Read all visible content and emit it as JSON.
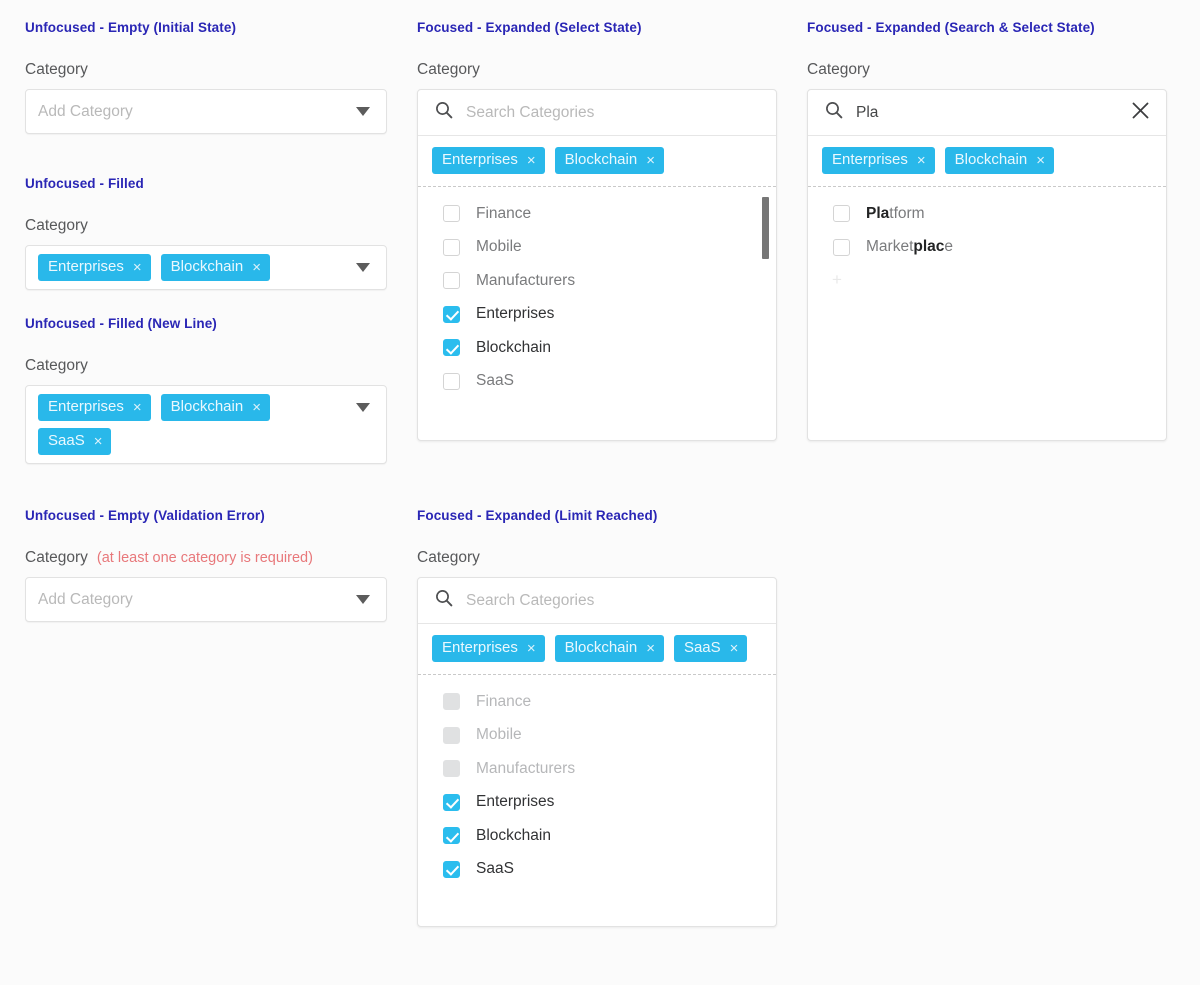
{
  "page": {
    "background": "#fbfbfb",
    "accent_color": "#29b8ea",
    "title_color": "#2a26b5",
    "error_color": "#e8787b"
  },
  "panels": {
    "initial": {
      "state_title": "Unfocused - Empty (Initial State)",
      "field_label": "Category",
      "placeholder": "Add Category"
    },
    "filled": {
      "state_title": "Unfocused - Filled",
      "field_label": "Category",
      "chips": [
        {
          "label": "Enterprises",
          "close": "×"
        },
        {
          "label": "Blockchain",
          "close": "×"
        }
      ]
    },
    "filled_newline": {
      "state_title": "Unfocused - Filled (New Line)",
      "field_label": "Category",
      "chips": [
        {
          "label": "Enterprises",
          "close": "×"
        },
        {
          "label": "Blockchain",
          "close": "×"
        },
        {
          "label": "SaaS",
          "close": "×"
        }
      ]
    },
    "validation_error": {
      "state_title": "Unfocused - Empty (Validation Error)",
      "field_label": "Category",
      "error_message": "(at least one category is required)",
      "placeholder": "Add Category"
    },
    "select_state": {
      "state_title": "Focused - Expanded (Select State)",
      "field_label": "Category",
      "search_placeholder": "Search Categories",
      "search_value": "",
      "chips": [
        {
          "label": "Enterprises",
          "close": "×"
        },
        {
          "label": "Blockchain",
          "close": "×"
        }
      ],
      "options": [
        {
          "label": "Finance",
          "checked": false,
          "disabled": false
        },
        {
          "label": "Mobile",
          "checked": false,
          "disabled": false
        },
        {
          "label": "Manufacturers",
          "checked": false,
          "disabled": false
        },
        {
          "label": "Enterprises",
          "checked": true,
          "disabled": false
        },
        {
          "label": "Blockchain",
          "checked": true,
          "disabled": false
        },
        {
          "label": "SaaS",
          "checked": false,
          "disabled": false
        }
      ]
    },
    "search_select_state": {
      "state_title": "Focused - Expanded (Search & Select State)",
      "field_label": "Category",
      "search_placeholder": "Search Categories",
      "search_value": "Pla",
      "clear_icon": "close-icon",
      "chips": [
        {
          "label": "Enterprises",
          "close": "×"
        },
        {
          "label": "Blockchain",
          "close": "×"
        }
      ],
      "results": [
        {
          "pre": "",
          "match": "Pla",
          "post": "tform",
          "checked": false
        },
        {
          "pre": "Market",
          "match": "plac",
          "post": "e",
          "checked": false
        }
      ],
      "add_new_icon": "+"
    },
    "limit_reached": {
      "state_title": "Focused - Expanded (Limit Reached)",
      "field_label": "Category",
      "search_placeholder": "Search Categories",
      "search_value": "",
      "chips": [
        {
          "label": "Enterprises",
          "close": "×"
        },
        {
          "label": "Blockchain",
          "close": "×"
        },
        {
          "label": "SaaS",
          "close": "×"
        }
      ],
      "options": [
        {
          "label": "Finance",
          "checked": false,
          "disabled": true
        },
        {
          "label": "Mobile",
          "checked": false,
          "disabled": true
        },
        {
          "label": "Manufacturers",
          "checked": false,
          "disabled": true
        },
        {
          "label": "Enterprises",
          "checked": true,
          "disabled": false
        },
        {
          "label": "Blockchain",
          "checked": true,
          "disabled": false
        },
        {
          "label": "SaaS",
          "checked": true,
          "disabled": false
        }
      ]
    }
  }
}
